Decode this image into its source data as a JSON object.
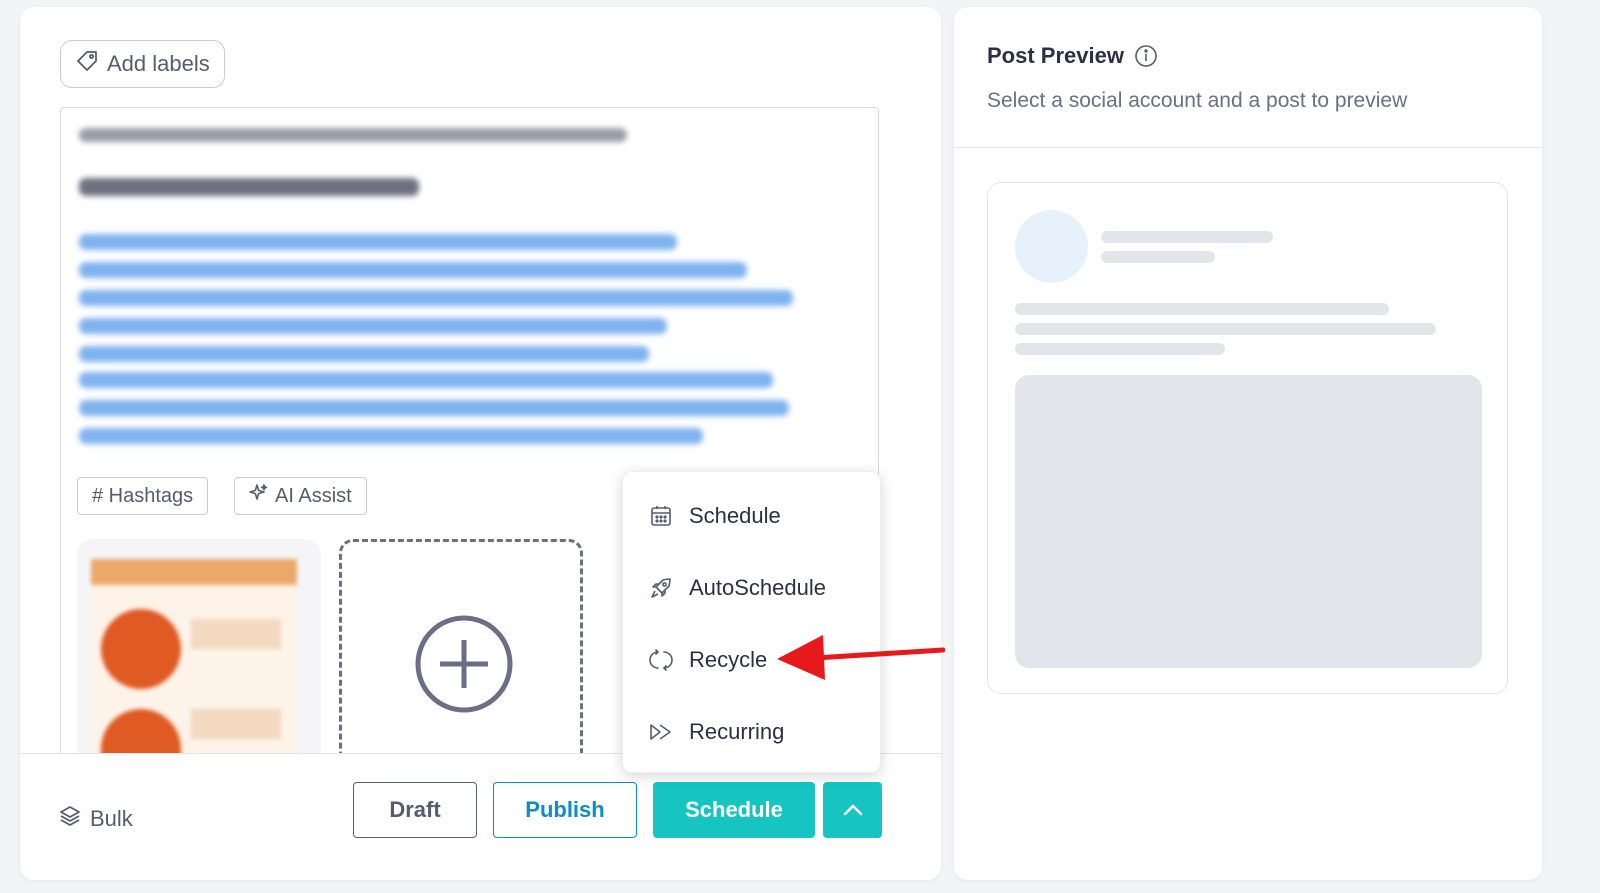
{
  "editor": {
    "add_labels": "Add labels",
    "hashtags_label": "# Hashtags",
    "ai_assist_label": "AI Assist"
  },
  "schedule_menu": {
    "items": [
      {
        "label": "Schedule",
        "icon": "calendar-icon"
      },
      {
        "label": "AutoSchedule",
        "icon": "rocket-icon"
      },
      {
        "label": "Recycle",
        "icon": "recycle-icon"
      },
      {
        "label": "Recurring",
        "icon": "fast-forward-icon"
      }
    ]
  },
  "footer": {
    "bulk_label": "Bulk",
    "draft_label": "Draft",
    "publish_label": "Publish",
    "schedule_label": "Schedule"
  },
  "preview": {
    "title": "Post Preview",
    "subtitle": "Select a social account and a post to preview"
  },
  "colors": {
    "accent": "#16c5c2",
    "publish_blue": "#0a8ec5",
    "annotation_arrow": "#e8191b"
  }
}
